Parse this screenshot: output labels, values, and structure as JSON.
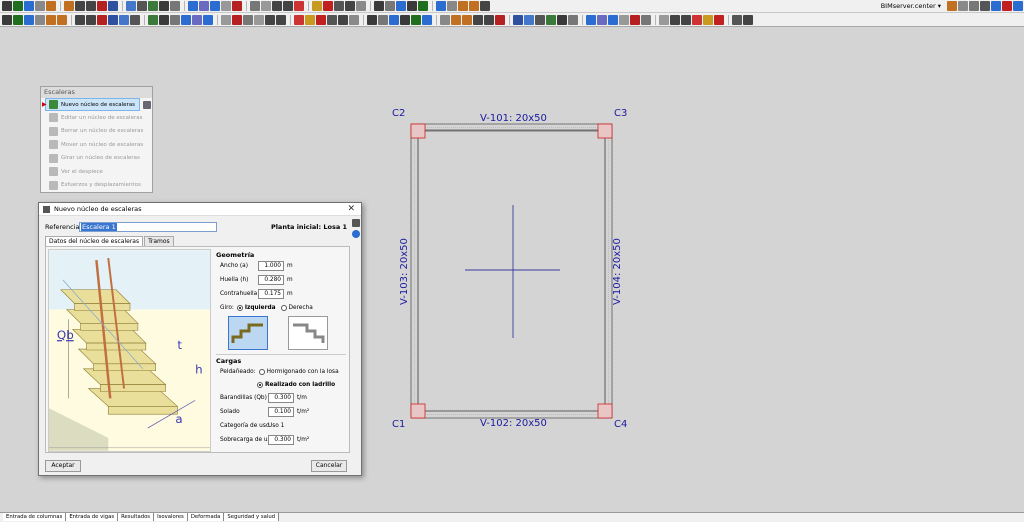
{
  "toolbar": {
    "server_label": "BIMserver.center ▾",
    "icon_colors": [
      "#2f4f9f",
      "#444",
      "#777",
      "#3a3a3a",
      "#b52020",
      "#c07020",
      "#cc3333",
      "#4477cc",
      "#8a8a8a",
      "#2a6cd0",
      "#1f6f1f",
      "#777",
      "#444",
      "#c89a20",
      "#555",
      "#3a3a3a",
      "#6a6ac0",
      "#2a6cd0",
      "#999",
      "#444",
      "#c02020",
      "#3a7a3a",
      "#777",
      "#2a6cd0",
      "#888",
      "#444",
      "#b52020",
      "#555",
      "#3a3a3a",
      "#2a6cd0",
      "#999",
      "#c07020",
      "#444"
    ]
  },
  "menu": {
    "title": "Escaleras",
    "items": [
      "Nuevo núcleo de escaleras",
      "Editar un núcleo de escaleras",
      "Borrar un núcleo de escaleras",
      "Mover un núcleo de escaleras",
      "Girar un núcleo de escaleras",
      "Ver el despiece",
      "Esfuerzos y desplazamientos"
    ]
  },
  "dialog": {
    "title": "Nuevo núcleo de escaleras",
    "close": "✕",
    "referencia_label": "Referencia",
    "referencia_value": "Escalera 1",
    "planta_inicial": "Planta inicial: Losa 1",
    "tabs": [
      "Datos del núcleo de escaleras",
      "Tramos"
    ],
    "geometria": {
      "title": "Geometría",
      "ancho_label": "Ancho (a)",
      "ancho_value": "1.000",
      "ancho_unit": "m",
      "huella_label": "Huella (h)",
      "huella_value": "0.280",
      "huella_unit": "m",
      "contrahuella_label": "Contrahuella (t)",
      "contrahuella_value": "0.175",
      "contrahuella_unit": "m",
      "giro_label": "Giro:",
      "izquierda": "Izquierda",
      "derecha": "Derecha"
    },
    "cargas": {
      "title": "Cargas",
      "peldaneado_label": "Peldañeado:",
      "opcion1": "Hormigonado con la losa",
      "opcion2": "Realizado con ladrillo",
      "barandillas_label": "Barandillas (Qb)",
      "barandillas_value": "0.300",
      "barandillas_unit": "t/m",
      "solado_label": "Solado",
      "solado_value": "0.100",
      "solado_unit": "t/m²",
      "categoria_label": "Categoría de uso",
      "categoria_value": "Uso 1",
      "sobrecarga_label": "Sobrecarga de uso",
      "sobrecarga_value": "0.300",
      "sobrecarga_unit": "t/m²"
    },
    "image_labels": {
      "qb": "Qb",
      "t": "t",
      "h": "h",
      "a": "a"
    },
    "accept": "Aceptar",
    "cancel": "Cancelar"
  },
  "plan": {
    "c1": "C1",
    "c2": "C2",
    "c3": "C3",
    "c4": "C4",
    "v101": "V-101: 20x50",
    "v102": "V-102: 20x50",
    "v103": "V-103: 20x50",
    "v104": "V-104: 20x50"
  },
  "bottom_tabs": [
    "Entrada de columnas",
    "Entrada de vigas",
    "Resultados",
    "Isovalores",
    "Deformada",
    "Seguridad y salud"
  ]
}
